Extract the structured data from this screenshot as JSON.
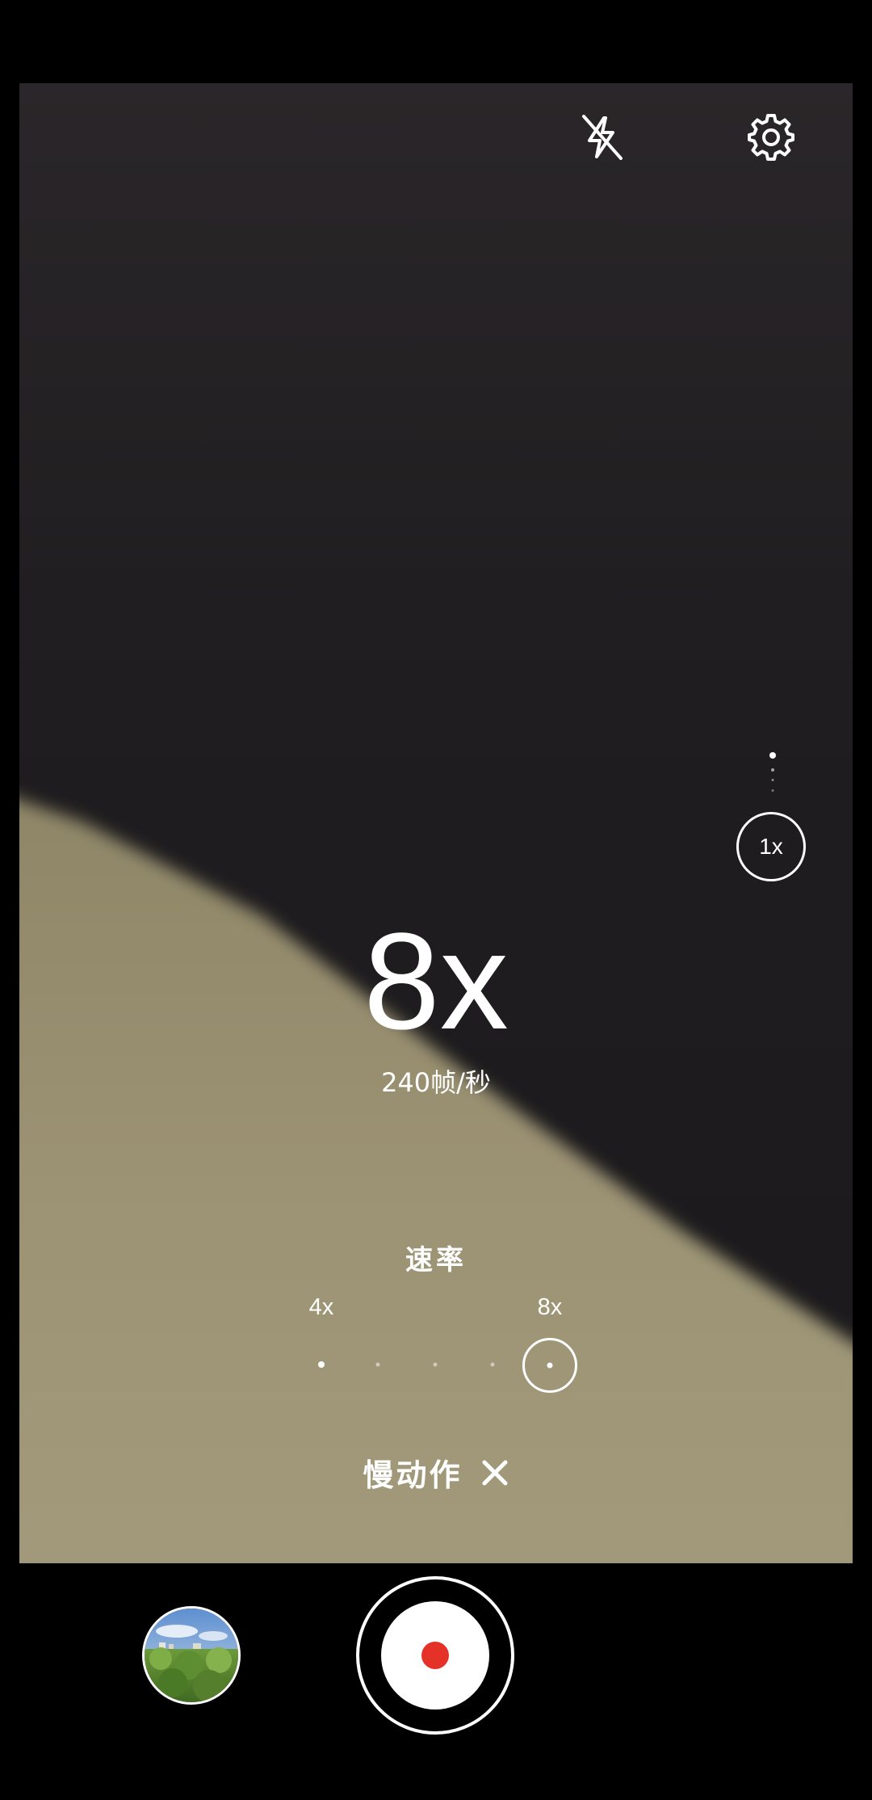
{
  "camera": {
    "mode_label": "慢动作",
    "flash_state": "off",
    "zoom_label": "1x",
    "speed_display": "8x",
    "fps_label": "240帧/秒",
    "rate": {
      "title": "速率",
      "options": [
        "4x",
        "8x"
      ],
      "selected": "8x"
    }
  },
  "icons": {
    "flash": "flash-off-icon",
    "settings": "gear-icon",
    "close": "close-icon",
    "record": "record-icon"
  },
  "colors": {
    "record": "#e53228",
    "viewfinder_dark": "#1e1c1e",
    "viewfinder_ground": "#9a9171"
  }
}
